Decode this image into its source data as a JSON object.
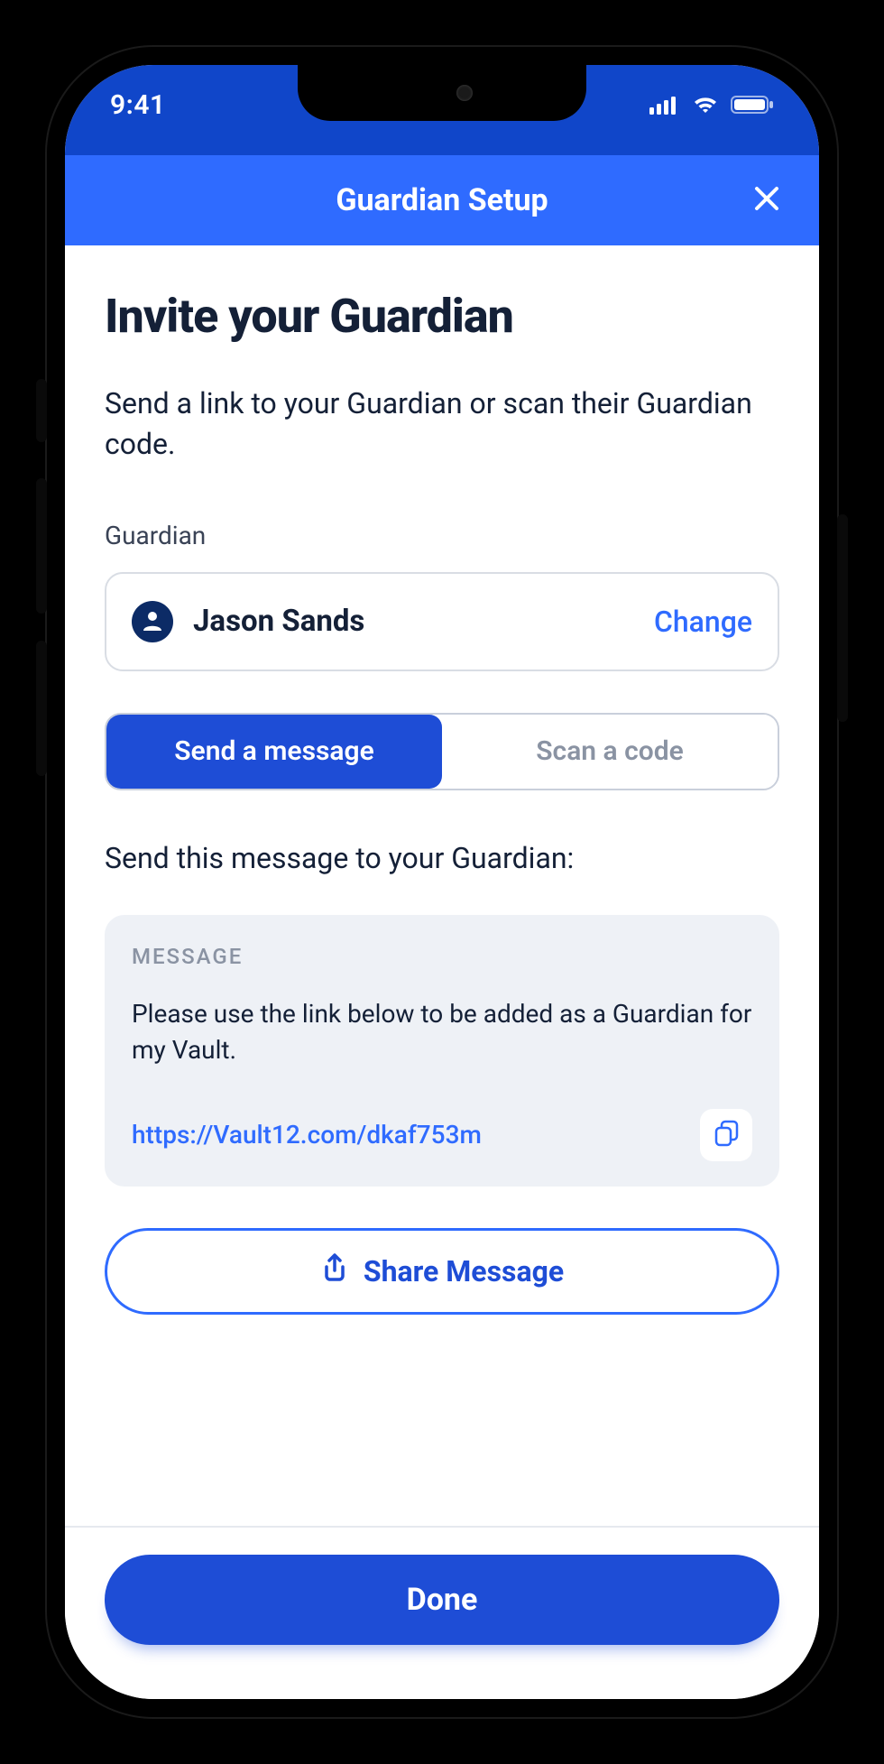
{
  "status": {
    "time": "9:41"
  },
  "nav": {
    "title": "Guardian Setup"
  },
  "page": {
    "title": "Invite your Guardian",
    "subtitle": "Send a link to your Guardian or scan their Guardian code."
  },
  "guardian": {
    "field_label": "Guardian",
    "name": "Jason Sands",
    "change_label": "Change"
  },
  "tabs": {
    "send": "Send a message",
    "scan": "Scan a code"
  },
  "message": {
    "prompt": "Send this message to your Guardian:",
    "label": "MESSAGE",
    "body": "Please use the link below to be added as a Guardian for my Vault.",
    "link": "https://Vault12.com/dkaf753m"
  },
  "buttons": {
    "share": "Share Message",
    "done": "Done"
  }
}
